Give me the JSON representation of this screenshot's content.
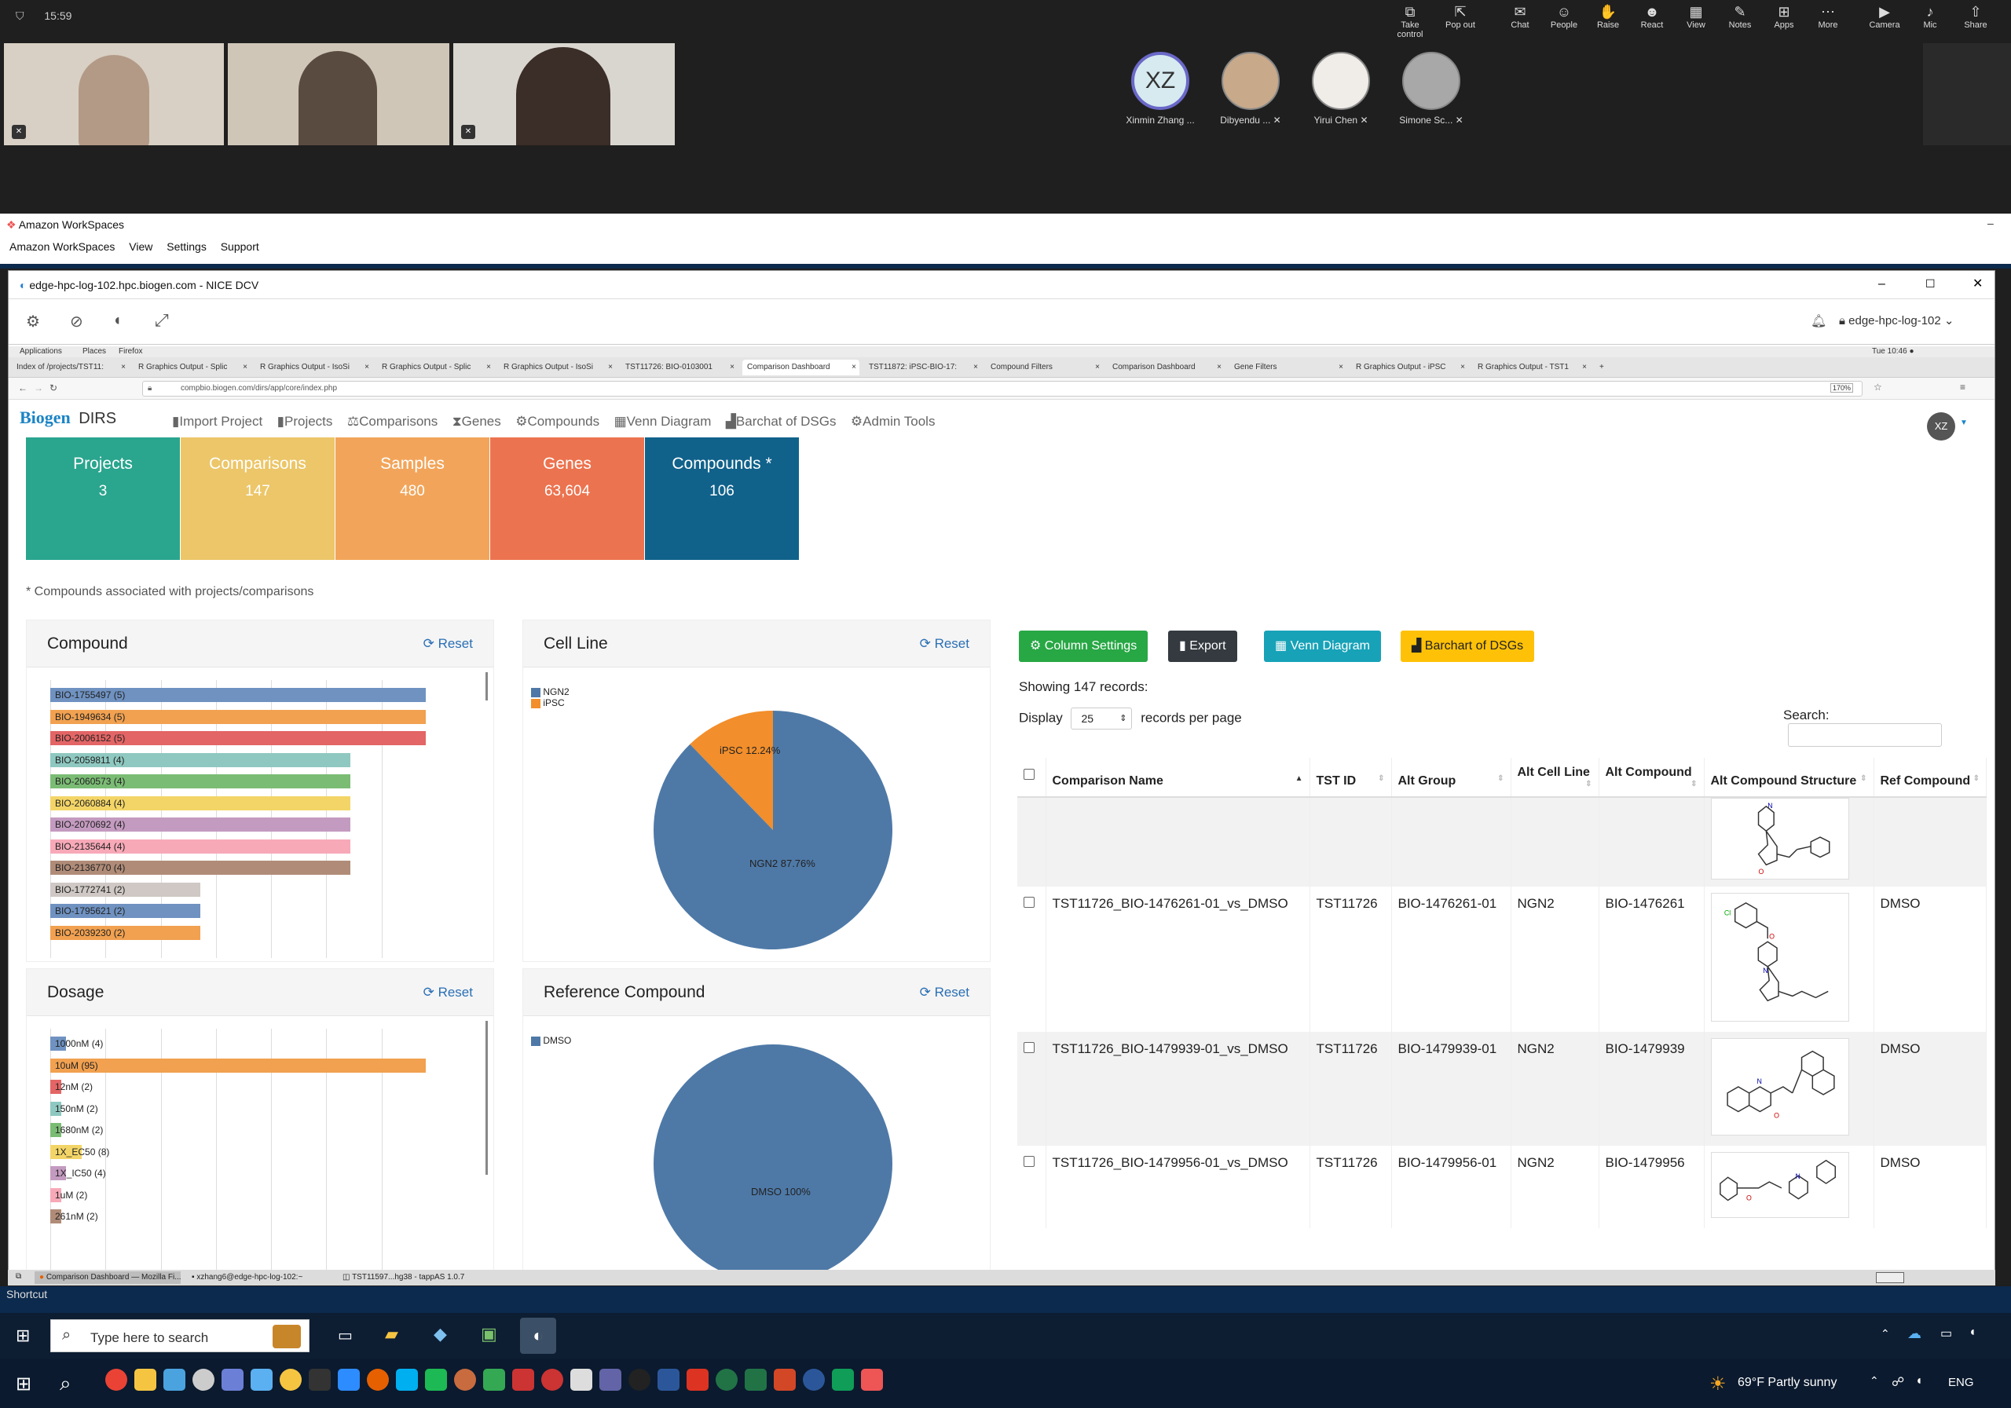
{
  "teams": {
    "time": "15:59",
    "toolbar": [
      "Take control",
      "Pop out",
      "Chat",
      "People",
      "Raise",
      "React",
      "View",
      "Notes",
      "Apps",
      "More",
      "Camera",
      "Mic",
      "Share"
    ],
    "participants": [
      {
        "initials": "XZ",
        "name": "Xinmin Zhang ..."
      },
      {
        "initials": "",
        "name": "Dibyendu ..."
      },
      {
        "initials": "",
        "name": "Yirui Chen"
      },
      {
        "initials": "",
        "name": "Simone Sc..."
      }
    ]
  },
  "workspaces": {
    "title": "Amazon WorkSpaces",
    "menu": [
      "Amazon WorkSpaces",
      "View",
      "Settings",
      "Support"
    ]
  },
  "dcv": {
    "title": "edge-hpc-log-102.hpc.biogen.com - NICE DCV",
    "host": "edge-hpc-log-102",
    "gnome": {
      "apps": "Applications",
      "places": "Places",
      "firefox": "Firefox",
      "clock": "Tue 10:46 ●"
    },
    "tabs": [
      "Index of /projects/TST11:",
      "R Graphics Output - Splic",
      "R Graphics Output - IsoSi",
      "R Graphics Output - Splic",
      "R Graphics Output - IsoSi",
      "TST11726: BIO-0103001",
      "Comparison Dashboard",
      "TST11872: iPSC-BIO-17:",
      "Compound Filters",
      "Comparison Dashboard",
      "Gene Filters",
      "R Graphics Output - iPSC",
      "R Graphics Output - TST1"
    ],
    "url": "compbio.biogen.com/dirs/app/core/index.php",
    "zoom": "170%",
    "taskbar": [
      "Comparison Dashboard — Mozilla Fi...",
      "xzhang6@edge-hpc-log-102:~",
      "TST11597...hg38 - tappAS 1.0.7"
    ]
  },
  "app": {
    "brand": "Biogen",
    "product": "DIRS",
    "nav": [
      "Import Project",
      "Projects",
      "Comparisons",
      "Genes",
      "Compounds",
      "Venn Diagram",
      "Barchat of DSGs",
      "Admin Tools"
    ],
    "user_initials": "XZ",
    "stats": [
      {
        "label": "Projects",
        "value": "3",
        "color": "#2aa58e"
      },
      {
        "label": "Comparisons",
        "value": "147",
        "color": "#ecc668"
      },
      {
        "label": "Samples",
        "value": "480",
        "color": "#f2a55a"
      },
      {
        "label": "Genes",
        "value": "63,604",
        "color": "#ec734f"
      },
      {
        "label": "Compounds *",
        "value": "106",
        "color": "#10628b"
      }
    ],
    "footnote": "* Compounds associated with projects/comparisons",
    "reset": "Reset",
    "compound_panel": {
      "title": "Compound",
      "bars": [
        {
          "label": "BIO-1755497 (5)",
          "value": 5,
          "color": "#6f92c1"
        },
        {
          "label": "BIO-1949634 (5)",
          "value": 5,
          "color": "#f1a150"
        },
        {
          "label": "BIO-2006152 (5)",
          "value": 5,
          "color": "#e36565"
        },
        {
          "label": "BIO-2059811 (4)",
          "value": 4,
          "color": "#8ec8c0"
        },
        {
          "label": "BIO-2060573 (4)",
          "value": 4,
          "color": "#7bbc75"
        },
        {
          "label": "BIO-2060884 (4)",
          "value": 4,
          "color": "#f3d567"
        },
        {
          "label": "BIO-2070692 (4)",
          "value": 4,
          "color": "#c49bc0"
        },
        {
          "label": "BIO-2135644 (4)",
          "value": 4,
          "color": "#f7a9b8"
        },
        {
          "label": "BIO-2136770 (4)",
          "value": 4,
          "color": "#b08c78"
        },
        {
          "label": "BIO-1772741 (2)",
          "value": 2,
          "color": "#cfc8c4"
        },
        {
          "label": "BIO-1795621 (2)",
          "value": 2,
          "color": "#6f92c1"
        },
        {
          "label": "BIO-2039230 (2)",
          "value": 2,
          "color": "#f1a150"
        }
      ]
    },
    "cellline_panel": {
      "title": "Cell Line",
      "legend": [
        "NGN2",
        "iPSC"
      ],
      "slices": [
        {
          "name": "NGN2",
          "label": "NGN2 87.76%",
          "value": 87.76,
          "color": "#4e79a7"
        },
        {
          "name": "iPSC",
          "label": "iPSC 12.24%",
          "value": 12.24,
          "color": "#f28e2b"
        }
      ]
    },
    "dosage_panel": {
      "title": "Dosage",
      "bars": [
        {
          "label": "1000nM (4)",
          "value": 4,
          "color": "#6f92c1"
        },
        {
          "label": "10uM (95)",
          "value": 95,
          "color": "#f1a150"
        },
        {
          "label": "12nM (2)",
          "value": 2,
          "color": "#e36565"
        },
        {
          "label": "150nM (2)",
          "value": 2,
          "color": "#8ec8c0"
        },
        {
          "label": "1680nM (2)",
          "value": 2,
          "color": "#7bbc75"
        },
        {
          "label": "1X_EC50 (8)",
          "value": 8,
          "color": "#f3d567"
        },
        {
          "label": "1X_IC50 (4)",
          "value": 4,
          "color": "#c49bc0"
        },
        {
          "label": "1uM (2)",
          "value": 2,
          "color": "#f7a9b8"
        },
        {
          "label": "261nM (2)",
          "value": 2,
          "color": "#b08c78"
        }
      ]
    },
    "refcompound_panel": {
      "title": "Reference Compound",
      "legend": [
        "DMSO"
      ],
      "slices": [
        {
          "name": "DMSO",
          "label": "DMSO 100%",
          "value": 100,
          "color": "#4e79a7"
        }
      ]
    },
    "table": {
      "buttons": [
        {
          "label": "Column Settings",
          "color": "#28a745"
        },
        {
          "label": "Export",
          "color": "#343a40"
        },
        {
          "label": "Venn Diagram",
          "color": "#17a2b8"
        },
        {
          "label": "Barchart of DSGs",
          "color": "#ffc107"
        }
      ],
      "showing": "Showing 147 records:",
      "display_label": "Display",
      "page_size": "25",
      "per_page": "records per page",
      "search_label": "Search:",
      "headers": [
        "Comparison Name",
        "TST ID",
        "Alt Group",
        "Alt Cell Line",
        "Alt Compound",
        "Alt Compound Structure",
        "Ref Compound"
      ],
      "rows": [
        {
          "name": "",
          "tst": "",
          "group": "",
          "cell": "",
          "compound": "",
          "ref": ""
        },
        {
          "name": "TST11726_BIO-1476261-01_vs_DMSO",
          "tst": "TST11726",
          "group": "BIO-1476261-01",
          "cell": "NGN2",
          "compound": "BIO-1476261",
          "ref": "DMSO"
        },
        {
          "name": "TST11726_BIO-1479939-01_vs_DMSO",
          "tst": "TST11726",
          "group": "BIO-1479939-01",
          "cell": "NGN2",
          "compound": "BIO-1479939",
          "ref": "DMSO"
        },
        {
          "name": "TST11726_BIO-1479956-01_vs_DMSO",
          "tst": "TST11726",
          "group": "BIO-1479956-01",
          "cell": "NGN2",
          "compound": "BIO-1479956",
          "ref": "DMSO"
        }
      ]
    }
  },
  "windows": {
    "search_placeholder": "Type here to search",
    "weather": "69°F Partly sunny",
    "lang": "ENG",
    "shortcut": "Shortcut"
  }
}
